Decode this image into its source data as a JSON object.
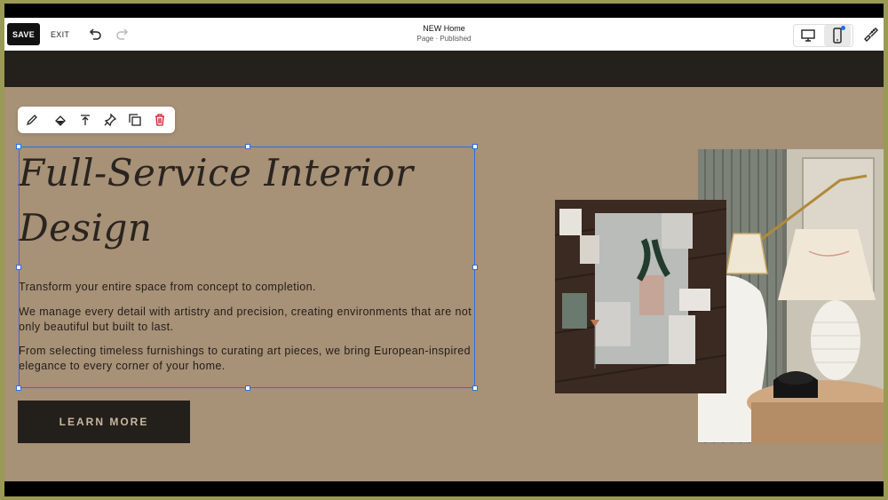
{
  "topbar": {
    "save_label": "SAVE",
    "exit_label": "EXIT",
    "page_title": "NEW Home",
    "page_status": "Page · Published",
    "undo_icon": "undo-icon",
    "redo_icon": "redo-icon",
    "desktop_icon": "desktop-icon",
    "mobile_icon": "mobile-icon",
    "design_icon": "paintbrush-icon"
  },
  "block_toolbar": {
    "icons": [
      "pencil-icon",
      "fill-icon",
      "align-top-icon",
      "pin-icon",
      "duplicate-icon",
      "trash-icon"
    ]
  },
  "content": {
    "heading": "Full-Service Interior Design",
    "paragraph_1": "Transform your entire space from concept to completion.",
    "paragraph_2": "We manage every detail with artistry and precision, creating environments that are not only beautiful but built to last.",
    "paragraph_3": "From selecting timeless furnishings to curating art pieces, we bring European-inspired elegance to every corner of your home.",
    "button_label": "LEARN MORE"
  },
  "colors": {
    "section_bg": "#a79177",
    "dark_band": "#24201c",
    "button_bg": "#231f1b",
    "button_text": "#c9b79e",
    "selection": "#2d6fe0",
    "accent_blue": "#1e6ee8",
    "frame_border": "#9a9a55"
  }
}
